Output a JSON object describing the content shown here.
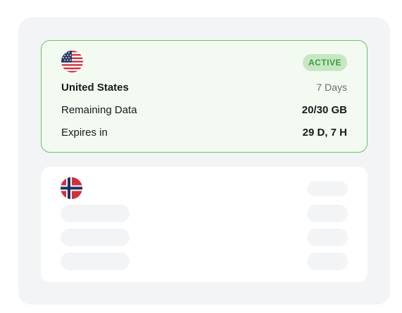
{
  "active_plan": {
    "flag_icon": "us-flag-icon",
    "status_badge": "ACTIVE",
    "country": "United States",
    "duration": "7 Days",
    "rows": [
      {
        "label": "Remaining Data",
        "value": "20/30 GB"
      },
      {
        "label": "Expires in",
        "value": "29 D, 7 H"
      }
    ]
  },
  "loading_plan": {
    "flag_icon": "norway-flag-icon",
    "state": "loading"
  },
  "colors": {
    "active_border": "#63c463",
    "active_bg": "#f2faf2",
    "badge_bg": "#c7e7c3",
    "badge_text": "#3e9d42",
    "skeleton": "#f3f4f6"
  }
}
